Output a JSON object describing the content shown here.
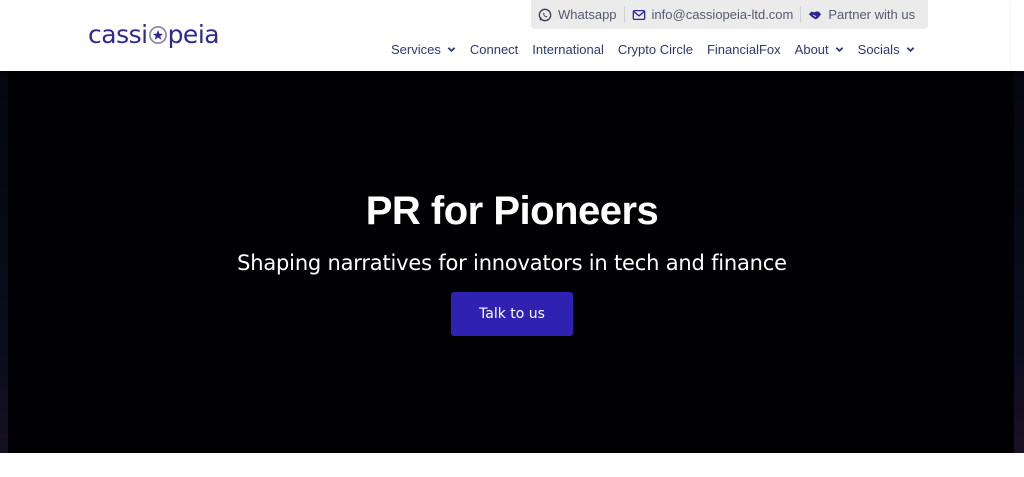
{
  "header": {
    "logo_text_left": "cassi",
    "logo_text_right": "peia",
    "contact": {
      "whatsapp_label": "Whatsapp",
      "email_label": "info@cassiopeia-ltd.com",
      "partner_label": "Partner with us"
    },
    "nav": [
      {
        "label": "Services",
        "has_dropdown": true
      },
      {
        "label": "Connect",
        "has_dropdown": false
      },
      {
        "label": "International",
        "has_dropdown": false
      },
      {
        "label": "Crypto Circle",
        "has_dropdown": false
      },
      {
        "label": "FinancialFox",
        "has_dropdown": false
      },
      {
        "label": "About",
        "has_dropdown": true
      },
      {
        "label": "Socials",
        "has_dropdown": true
      }
    ]
  },
  "hero": {
    "title": "PR for Pioneers",
    "subtitle": "Shaping narratives for innovators in tech and finance",
    "cta_label": "Talk to us"
  },
  "colors": {
    "brand": "#2e2a8f",
    "cta": "#2f22b2",
    "hero_bg": "#010103",
    "nav_text": "#2c3a6b"
  }
}
